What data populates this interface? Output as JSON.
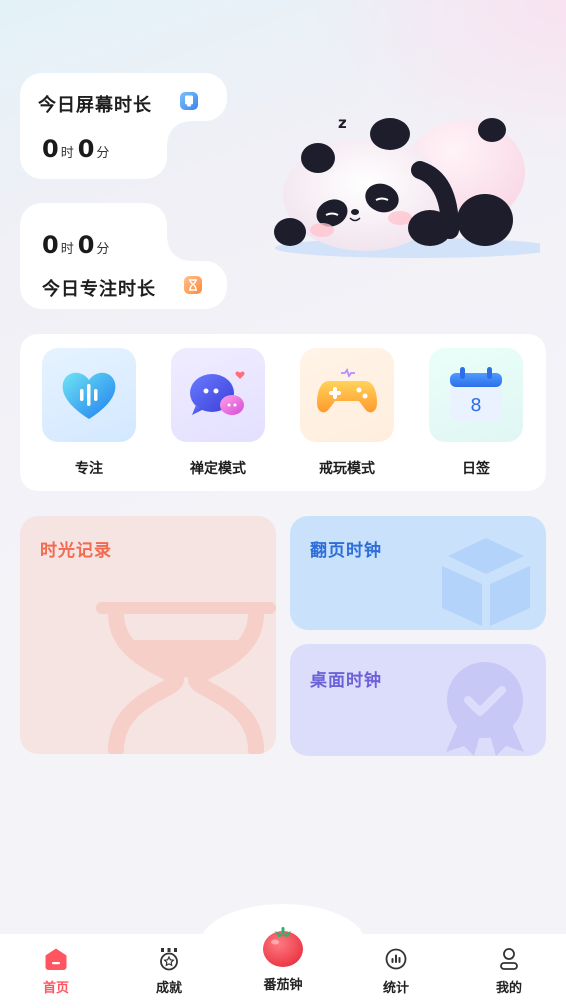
{
  "stats": {
    "screen_time": {
      "title": "今日屏幕时长",
      "hours": "0",
      "hour_unit": "时",
      "minutes": "0",
      "minute_unit": "分"
    },
    "focus_time": {
      "title": "今日专注时长",
      "hours": "0",
      "hour_unit": "时",
      "minutes": "0",
      "minute_unit": "分"
    }
  },
  "features": [
    {
      "label": "专注",
      "icon": "heart-pulse-icon"
    },
    {
      "label": "禅定模式",
      "icon": "chat-bubble-icon"
    },
    {
      "label": "戒玩模式",
      "icon": "gamepad-icon"
    },
    {
      "label": "日签",
      "icon": "calendar-icon",
      "calendar_day": "8"
    }
  ],
  "cards": {
    "record": {
      "title": "时光记录",
      "icon": "hourglass-icon"
    },
    "flip_clock": {
      "title": "翻页时钟",
      "icon": "cube-icon"
    },
    "desk_clock": {
      "title": "桌面时钟",
      "icon": "badge-check-icon"
    }
  },
  "panda": {
    "sleep_text": "z"
  },
  "tab_bar": {
    "items": [
      {
        "label": "首页",
        "icon": "home-icon",
        "active": true
      },
      {
        "label": "成就",
        "icon": "medal-icon",
        "active": false
      },
      {
        "label": "番茄钟",
        "icon": "tomato-icon",
        "active": false
      },
      {
        "label": "统计",
        "icon": "stats-icon",
        "active": false
      },
      {
        "label": "我的",
        "icon": "profile-icon",
        "active": false
      }
    ]
  },
  "colors": {
    "accent_red": "#ff5560",
    "record_title": "#f26a4f",
    "flip_title": "#2e6ed9",
    "desk_title": "#6b62d8"
  }
}
